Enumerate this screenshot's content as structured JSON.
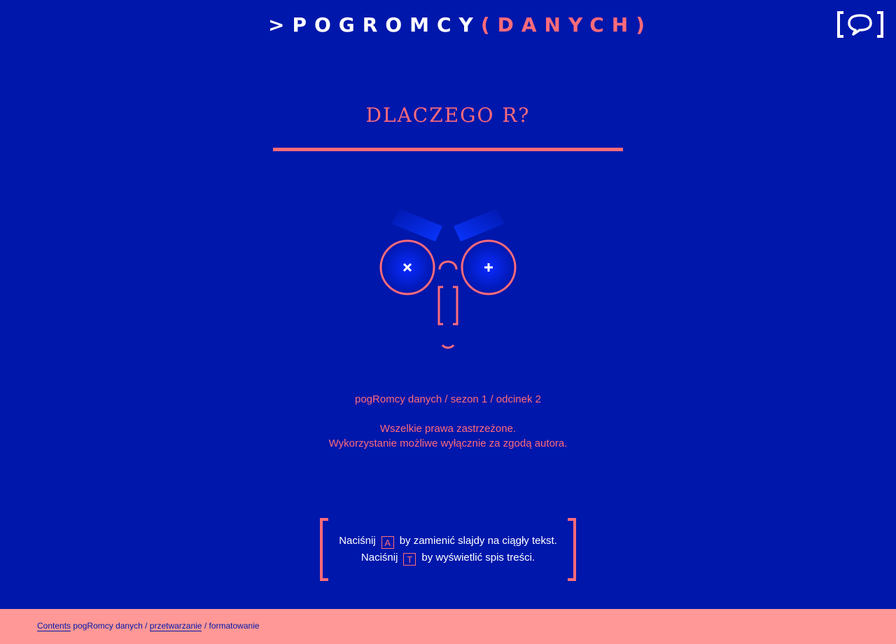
{
  "header": {
    "logo": {
      "prompt": ">",
      "brand": "POGROMCY",
      "paren_open": "(",
      "brand_secondary": "DANYCH",
      "paren_close": ")"
    },
    "chat_icon": "speech-bubble-icon"
  },
  "slide": {
    "title": "DLACZEGO R?",
    "episode": "pogRomcy danych / sezon 1 / odcinek 2",
    "rights_line1": "Wszelkie prawa zastrzeżone.",
    "rights_line2": "Wykorzystanie możliwe wyłącznie za zgodą autora."
  },
  "hint": {
    "line1_prefix": "Naciśnij",
    "line1_key": "A",
    "line1_suffix": "by zamienić slajdy na ciągły tekst.",
    "line2_prefix": "Naciśnij",
    "line2_key": "T",
    "line2_suffix": "by wyświetlić spis treści."
  },
  "footer": {
    "breadcrumb": {
      "contents_link": "Contents",
      "part1": "pogRomcy danych /",
      "link2": "przetwarzanie",
      "part3": "/ formatowanie"
    }
  },
  "colors": {
    "background": "#0017ab",
    "accent": "#ff6b7a",
    "footer": "#ff9896",
    "text_light": "#ffffff"
  }
}
